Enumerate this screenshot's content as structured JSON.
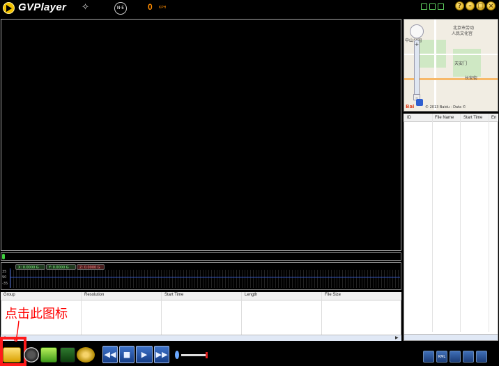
{
  "app": {
    "title": "GVPlayer"
  },
  "status": {
    "speed_value": "0",
    "speed_unit": "KPH"
  },
  "sensor": {
    "x_readout": "X: 0.0000 G",
    "y_readout": "Y: 0.0000 G",
    "z_readout": "Z: 0.0000 G",
    "scale": [
      "35",
      "90",
      "-35"
    ]
  },
  "file_table": {
    "columns": [
      "Group",
      "Resolution",
      "Start Time",
      "Length",
      "File Size"
    ]
  },
  "gps_table": {
    "columns": [
      "ID",
      "File Name",
      "Start Time",
      "En"
    ]
  },
  "map": {
    "labels": [
      "北京市劳动",
      "人民文化宫",
      "中山公园",
      "天安门",
      "长安街"
    ],
    "logo": "Bai",
    "copyright": "© 2013 Baidu - Data ©"
  },
  "annotation": {
    "text": "点击此图标"
  },
  "toolbar": {
    "right_buttons": [
      "",
      "KML",
      "",
      "",
      ""
    ]
  },
  "playback": {
    "progress": 0,
    "volume": 0.9
  },
  "colors": {
    "accent": "#ff8c00",
    "annotation": "#ff0000",
    "playback": "#2a5fb5"
  }
}
